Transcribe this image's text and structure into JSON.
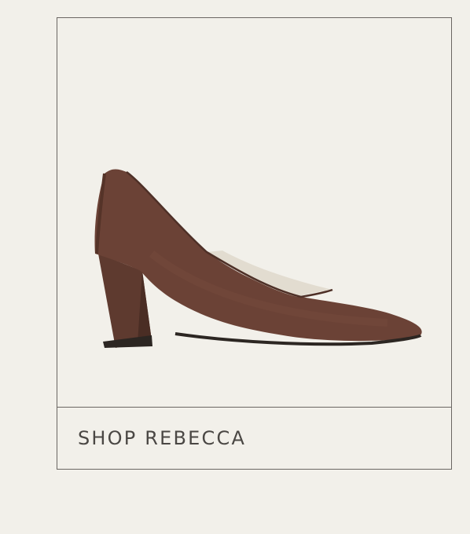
{
  "product": {
    "image_icon": "brown-suede-block-heel-pump",
    "cta_label": "SHOP REBECCA"
  },
  "colors": {
    "background": "#f2f0ea",
    "border": "#6a6662",
    "text": "#4a4744",
    "shoe": "#6b4236"
  }
}
